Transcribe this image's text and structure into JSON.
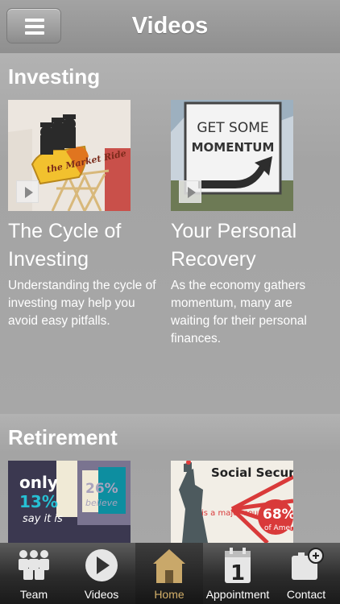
{
  "header": {
    "title": "Videos"
  },
  "sections": [
    {
      "title": "Investing",
      "cards": [
        {
          "thumb_text": "the Market Ride",
          "title": "The Cycle of Investing",
          "description": "Understanding the cycle of investing may help you avoid easy pitfalls."
        },
        {
          "thumb_text_1": "GET SOME",
          "thumb_text_2": "MOMENTUM",
          "title": "Your Personal Recovery",
          "description": "As the economy gathers momentum, many are waiting for their personal finances."
        }
      ]
    },
    {
      "title": "Retirement",
      "cards": [
        {
          "thumb_text_1": "only",
          "thumb_text_2": "13%",
          "thumb_text_3": "say it is",
          "thumb_text_4": "26%",
          "thumb_text_5": "believe"
        },
        {
          "thumb_text_1": "Social Securit",
          "thumb_text_2": "is a major source of income for",
          "thumb_text_3": "68%",
          "thumb_text_4": "of Americ"
        }
      ]
    }
  ],
  "tabbar": {
    "items": [
      {
        "label": "Team",
        "icon": "team-icon"
      },
      {
        "label": "Videos",
        "icon": "play-icon"
      },
      {
        "label": "Home",
        "icon": "home-icon",
        "active": true
      },
      {
        "label": "Appointment",
        "icon": "calendar-icon",
        "day": "1"
      },
      {
        "label": "Contact",
        "icon": "add-contact-icon"
      }
    ]
  },
  "colors": {
    "active_tab": "#d4b06a",
    "background": "#a6a6a6"
  }
}
